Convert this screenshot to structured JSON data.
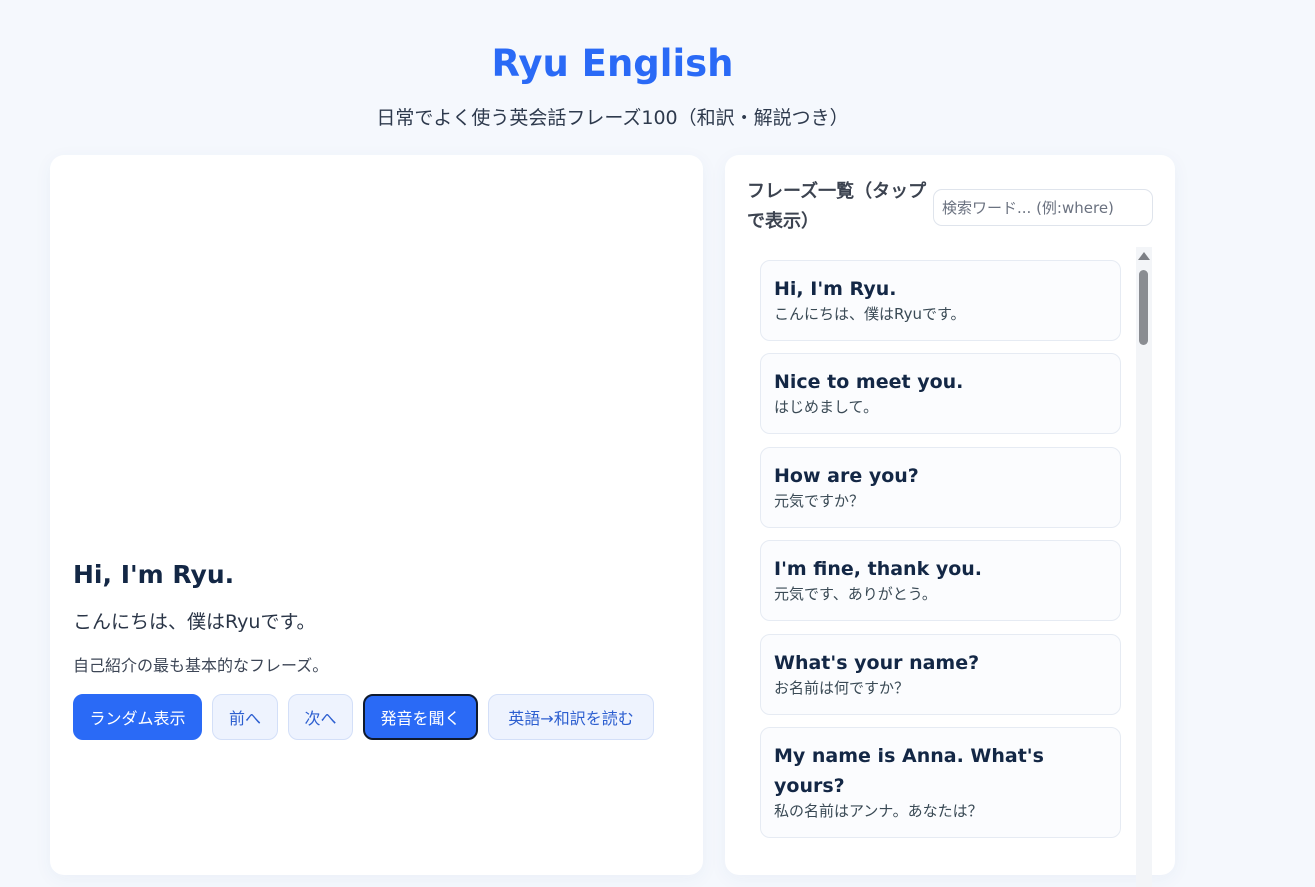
{
  "header": {
    "title": "Ryu English",
    "subtitle": "日常でよく使う英会話フレーズ100（和訳・解説つき）"
  },
  "current": {
    "english": "Hi, I'm Ryu.",
    "japanese": "こんにちは、僕はRyuです。",
    "note": "自己紹介の最も基本的なフレーズ。"
  },
  "buttons": {
    "random": "ランダム表示",
    "prev": "前へ",
    "next": "次へ",
    "listen": "発音を聞く",
    "read": "英語→和訳を読む"
  },
  "list": {
    "heading": "フレーズ一覧（タップで表示）",
    "search_placeholder": "検索ワード... (例:where)",
    "items": [
      {
        "en": "Hi, I'm Ryu.",
        "ja": "こんにちは、僕はRyuです。"
      },
      {
        "en": "Nice to meet you.",
        "ja": "はじめまして。"
      },
      {
        "en": "How are you?",
        "ja": "元気ですか？"
      },
      {
        "en": "I'm fine, thank you.",
        "ja": "元気です、ありがとう。"
      },
      {
        "en": "What's your name?",
        "ja": "お名前は何ですか？"
      },
      {
        "en": "My name is Anna. What's yours?",
        "ja": "私の名前はアンナ。あなたは？"
      }
    ]
  },
  "colors": {
    "accent": "#2a6af6",
    "background": "#f5f8fd"
  }
}
